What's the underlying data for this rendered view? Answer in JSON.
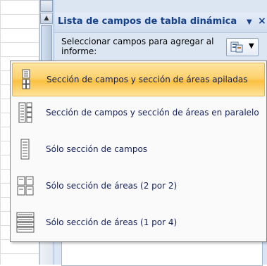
{
  "pane": {
    "title": "Lista de campos de tabla dinámica",
    "subtitle": "Seleccionar campos para agregar al informe:",
    "dropdown_icon": "▼",
    "close_icon": "×"
  },
  "layout_button": {
    "icon": "field-layout-icon",
    "arrow": "▼"
  },
  "menu": {
    "items": [
      {
        "label": "Sección de campos y sección de áreas apiladas",
        "icon": "stacked-sections-icon",
        "selected": true
      },
      {
        "label": "Sección de campos y sección de áreas en paralelo",
        "icon": "side-by-side-sections-icon",
        "selected": false
      },
      {
        "label": "Sólo sección de campos",
        "icon": "fields-only-icon",
        "selected": false
      },
      {
        "label": "Sólo sección de áreas (2 por 2)",
        "icon": "areas-2x2-icon",
        "selected": false
      },
      {
        "label": "Sólo sección de áreas (1 por 4)",
        "icon": "areas-1x4-icon",
        "selected": false
      }
    ]
  },
  "colors": {
    "title_text": "#15428b",
    "pane_background": "#dce6f3",
    "selected_highlight": "#fbc040",
    "menu_text": "#13205a"
  }
}
